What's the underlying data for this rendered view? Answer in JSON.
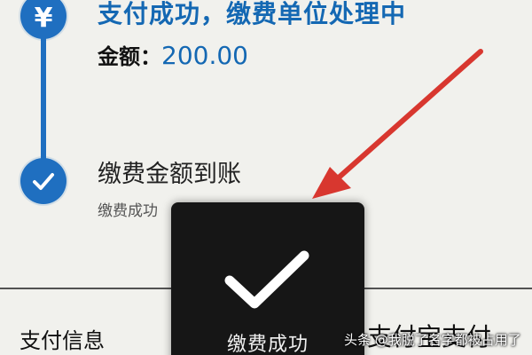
{
  "status": {
    "title": "支付成功，缴费单位处理中",
    "amount_label": "金额：",
    "amount_value": "200.00",
    "step2_title": "缴费金额到账",
    "step2_sub": "缴费成功"
  },
  "section": {
    "pay_info_label": "支付信息",
    "pay_method": "支付宝支付"
  },
  "toast": {
    "message": "缴费成功"
  },
  "watermark": "头条 @我脱了名字都被占用了",
  "colors": {
    "accent": "#1468b3",
    "step_icon": "#1f6fc0",
    "arrow": "#d8372f",
    "toast_bg": "#161616"
  },
  "icons": {
    "step1": "yen-icon",
    "step2": "check-circle-icon",
    "toast": "check-icon",
    "annotation": "arrow-icon"
  }
}
